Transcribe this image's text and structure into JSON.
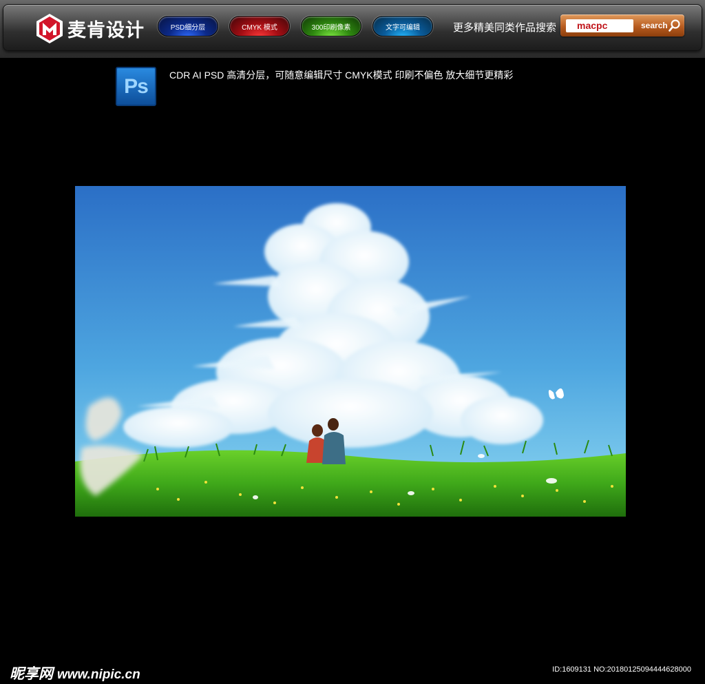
{
  "header": {
    "logo_text": "麦肯设计",
    "tags": [
      {
        "label": "PSD细分层",
        "color": "#0c2a8a"
      },
      {
        "label": "CMYK 模式",
        "color": "#a50e14"
      },
      {
        "label": "300印刷像素",
        "color": "#2f8a10"
      },
      {
        "label": "文字可编辑",
        "color": "#0a5c9b"
      }
    ],
    "more_text": "更多精美同类作品搜索",
    "search": {
      "value": "macpc",
      "button_label": "search"
    }
  },
  "info": {
    "app_icon": "Ps",
    "line": "CDR  AI   PSD 高清分层，可随意编辑尺寸  CMYK模式  印刷不偏色  放大细节更精彩"
  },
  "footer": {
    "watermark": "昵享网",
    "watermark_url": "www.nipic.cn",
    "id_text": "ID:1609131 NO:20180125094444628000"
  },
  "colors": {
    "page_bg": "#000000",
    "sky_top": "#2b6fc6",
    "sky_bottom": "#7ed0ee",
    "grass": "#3fa81a",
    "search_bg": "#b85c20",
    "brand_red": "#c0141a"
  }
}
